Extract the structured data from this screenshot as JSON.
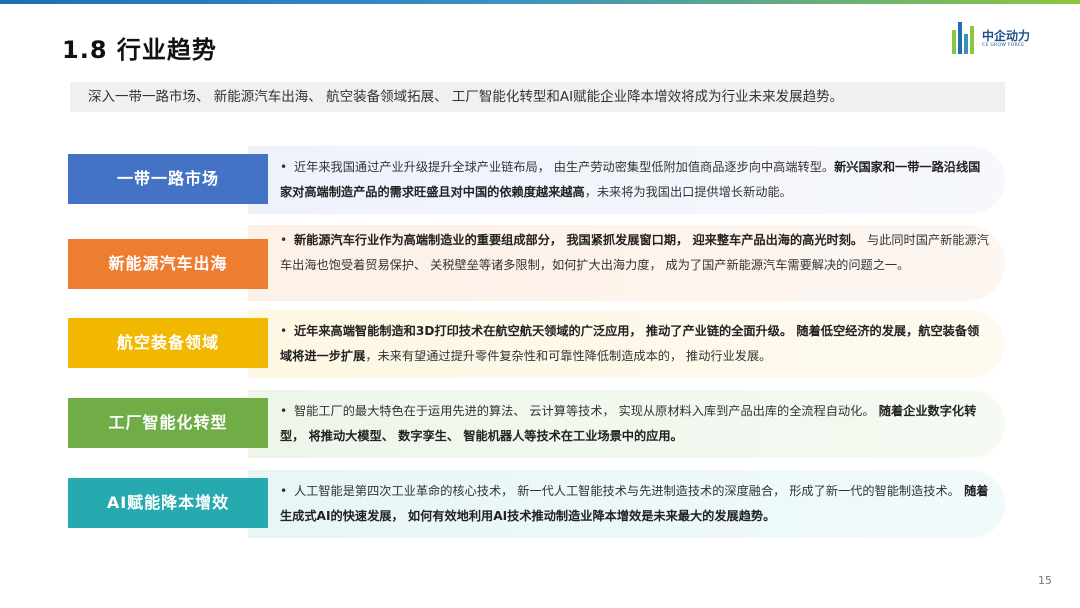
{
  "page": {
    "title": "1.8 行业趋势",
    "number": "15"
  },
  "logo": {
    "name": "中企动力",
    "tagline": "CE GROW FORCE"
  },
  "summary": "深入一带一路市场、 新能源汽车出海、 航空装备领域拓展、 工厂智能化转型和AI赋能企业降本增效将成为行业未来发展趋势。",
  "colors": {
    "belt_road": "#4472c4",
    "new_energy": "#ed7d31",
    "aviation": "#f2b800",
    "factory": "#70ad47",
    "ai": "#26aab0"
  },
  "trends": [
    {
      "label": "一带一路市场",
      "text_normal": "近年来我国通过产业升级提升全球产业链布局， 由生产劳动密集型低附加值商品逐步向中高端转型。",
      "text_bold": "新兴国家和一带一路沿线国家对高端制造产品的需求旺盛且对中国的依赖度越来越高",
      "text_tail": "，未来将为我国出口提供增长新动能。"
    },
    {
      "label": "新能源汽车出海",
      "text_bold": "新能源汽车行业作为高端制造业的重要组成部分， 我国紧抓发展窗口期， 迎来整车产品出海的高光时刻。",
      "text_tail": " 与此同时国产新能源汽车出海也饱受着贸易保护、 关税壁垒等诸多限制，如何扩大出海力度， 成为了国产新能源汽车需要解决的问题之一。"
    },
    {
      "label": "航空装备领域",
      "text_bold": "近年来高端智能制造和3D打印技术在航空航天领域的广泛应用， 推动了产业链的全面升级。 随着低空经济的发展，航空装备领域将进一步扩展",
      "text_tail": "，未来有望通过提升零件复杂性和可靠性降低制造成本的， 推动行业发展。"
    },
    {
      "label": "工厂智能化转型",
      "text_normal": "智能工厂的最大特色在于运用先进的算法、 云计算等技术， 实现从原材料入库到产品出库的全流程自动化。",
      "text_bold": " 随着企业数字化转型， 将推动大模型、 数字孪生、 智能机器人等技术在工业场景中的应用。",
      "text_tail": ""
    },
    {
      "label": "AI赋能降本增效",
      "text_normal": "人工智能是第四次工业革命的核心技术， 新一代人工智能技术与先进制造技术的深度融合， 形成了新一代的智能制造技术。",
      "text_bold": " 随着生成式AI的快速发展， 如何有效地利用AI技术推动制造业降本增效是未来最大的发展趋势。",
      "text_tail": ""
    }
  ]
}
